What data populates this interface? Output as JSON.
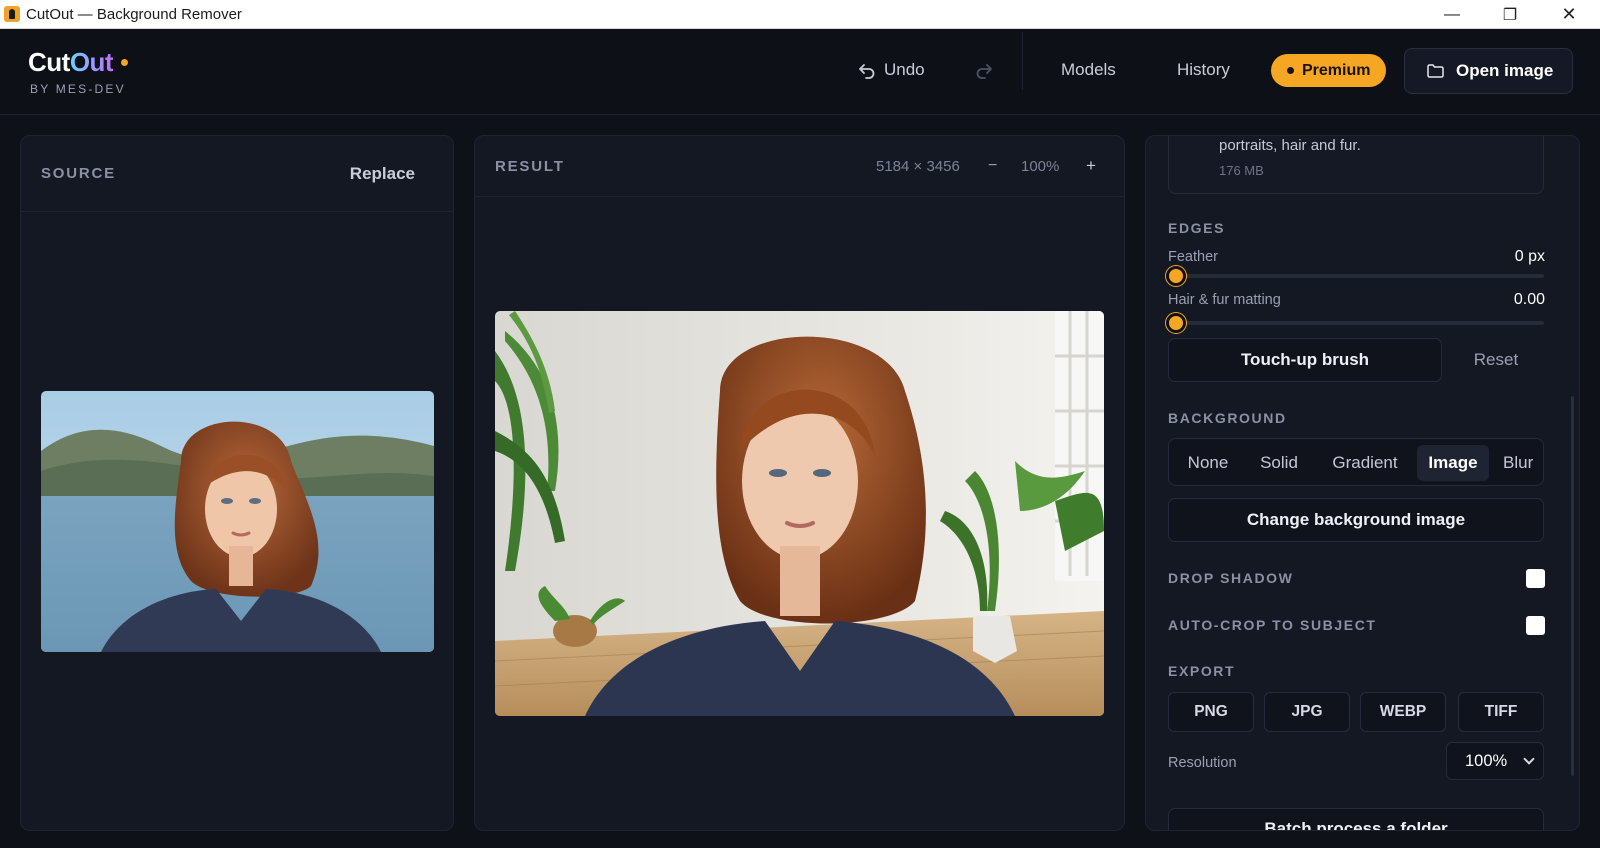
{
  "window": {
    "title": "CutOut — Background Remover",
    "controls": {
      "minimize": "—",
      "restore": "❐",
      "close": "✕"
    }
  },
  "header": {
    "brand_cut": "Cut",
    "brand_out": "Out",
    "byline": "BY MES-DEV",
    "undo_label": "Undo",
    "undo_icon": "undo-icon",
    "redo_icon": "redo-icon",
    "models_label": "Models",
    "history_label": "History",
    "premium_label": "Premium",
    "open_label": "Open image"
  },
  "source": {
    "label": "SOURCE",
    "replace_label": "Replace"
  },
  "result": {
    "label": "RESULT",
    "dimensions": "5184 × 3456",
    "zoom_out": "−",
    "zoom": "100%",
    "zoom_in": "+"
  },
  "sidebar": {
    "model_desc": "portraits, hair and fur.",
    "model_size": "176 MB",
    "edges_label": "EDGES",
    "feather_label": "Feather",
    "feather_value": "0 px",
    "feather_level": 0,
    "matting_label": "Hair & fur matting",
    "matting_value": "0.00",
    "matting_level": 0,
    "touchup_label": "Touch-up brush",
    "reset_label": "Reset",
    "background_label": "BACKGROUND",
    "bg_options": [
      "None",
      "Solid",
      "Gradient",
      "Image",
      "Blur"
    ],
    "bg_selected": "Image",
    "change_bg_label": "Change background image",
    "drop_shadow_label": "DROP SHADOW",
    "drop_shadow_checked": false,
    "autocrop_label": "AUTO-CROP TO SUBJECT",
    "autocrop_checked": false,
    "export_label": "EXPORT",
    "formats": [
      "PNG",
      "JPG",
      "WEBP",
      "TIFF"
    ],
    "resolution_label": "Resolution",
    "resolution_value": "100%",
    "batch_label": "Batch process a folder"
  },
  "colors": {
    "accent": "#f5a623",
    "background": "#0f1118",
    "panel": "#141823"
  }
}
